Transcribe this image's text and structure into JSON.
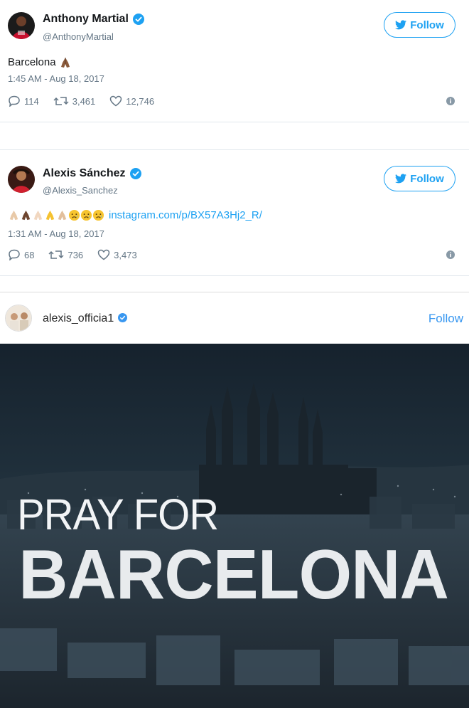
{
  "tweets": [
    {
      "display_name": "Anthony Martial",
      "handle": "@AnthonyMartial",
      "follow_label": "Follow",
      "text": "Barcelona",
      "emojis": [
        "folded-hands-dark"
      ],
      "link": "",
      "timestamp": "1:45 AM - Aug 18, 2017",
      "replies": "114",
      "retweets": "3,461",
      "likes": "12,746"
    },
    {
      "display_name": "Alexis Sánchez",
      "handle": "@Alexis_Sanchez",
      "follow_label": "Follow",
      "text": "",
      "emojis": [
        "folded-hands-light",
        "folded-hands-dark",
        "folded-hands-light",
        "folded-hands-yellow",
        "folded-hands-light",
        "crying-face",
        "crying-face",
        "crying-face"
      ],
      "link": "instagram.com/p/BX57A3Hj2_R/",
      "timestamp": "1:31 AM - Aug 18, 2017",
      "replies": "68",
      "retweets": "736",
      "likes": "3,473"
    }
  ],
  "instagram": {
    "username": "alexis_officia1",
    "follow_label": "Follow",
    "image_text_line1": "PRAY FOR",
    "image_text_line2": "BARCELONA"
  },
  "colors": {
    "twitter_blue": "#1da1f2",
    "instagram_blue": "#3897f0",
    "muted": "#657786"
  },
  "icons": [
    "verified-badge-icon",
    "twitter-bird-icon",
    "reply-icon",
    "retweet-icon",
    "like-icon",
    "info-icon"
  ]
}
